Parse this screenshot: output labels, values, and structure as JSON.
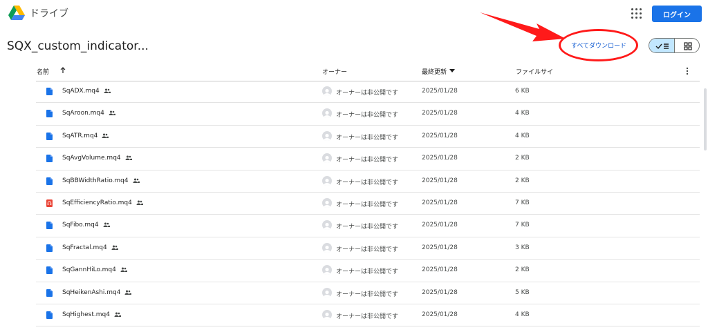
{
  "header": {
    "app_name": "ドライブ",
    "login_label": "ログイン"
  },
  "folder": {
    "title": "SQX_custom_indicator...",
    "download_all_label": "すべてダウンロード"
  },
  "columns": {
    "name": "名前",
    "owner": "オーナー",
    "modified": "最終更新",
    "size": "ファイルサイ"
  },
  "colors": {
    "accent": "#1a73e8",
    "doc_icon": "#1a73e8",
    "audio_icon": "#ea4335",
    "annotation": "#ff1a1a",
    "selected_view": "#c2e7ff"
  },
  "files": [
    {
      "name": "SqADX.mq4",
      "icon": "doc-icon",
      "owner": "オーナーは非公開です",
      "modified": "2025/01/28",
      "size": "6 KB"
    },
    {
      "name": "SqAroon.mq4",
      "icon": "doc-icon",
      "owner": "オーナーは非公開です",
      "modified": "2025/01/28",
      "size": "4 KB"
    },
    {
      "name": "SqATR.mq4",
      "icon": "doc-icon",
      "owner": "オーナーは非公開です",
      "modified": "2025/01/28",
      "size": "4 KB"
    },
    {
      "name": "SqAvgVolume.mq4",
      "icon": "doc-icon",
      "owner": "オーナーは非公開です",
      "modified": "2025/01/28",
      "size": "2 KB"
    },
    {
      "name": "SqBBWidthRatio.mq4",
      "icon": "doc-icon",
      "owner": "オーナーは非公開です",
      "modified": "2025/01/28",
      "size": "2 KB"
    },
    {
      "name": "SqEfficiencyRatio.mq4",
      "icon": "audio-icon",
      "owner": "オーナーは非公開です",
      "modified": "2025/01/28",
      "size": "7 KB"
    },
    {
      "name": "SqFibo.mq4",
      "icon": "doc-icon",
      "owner": "オーナーは非公開です",
      "modified": "2025/01/28",
      "size": "7 KB"
    },
    {
      "name": "SqFractal.mq4",
      "icon": "doc-icon",
      "owner": "オーナーは非公開です",
      "modified": "2025/01/28",
      "size": "3 KB"
    },
    {
      "name": "SqGannHiLo.mq4",
      "icon": "doc-icon",
      "owner": "オーナーは非公開です",
      "modified": "2025/01/28",
      "size": "2 KB"
    },
    {
      "name": "SqHeikenAshi.mq4",
      "icon": "doc-icon",
      "owner": "オーナーは非公開です",
      "modified": "2025/01/28",
      "size": "5 KB"
    },
    {
      "name": "SqHighest.mq4",
      "icon": "doc-icon",
      "owner": "オーナーは非公開です",
      "modified": "2025/01/28",
      "size": "4 KB"
    }
  ]
}
